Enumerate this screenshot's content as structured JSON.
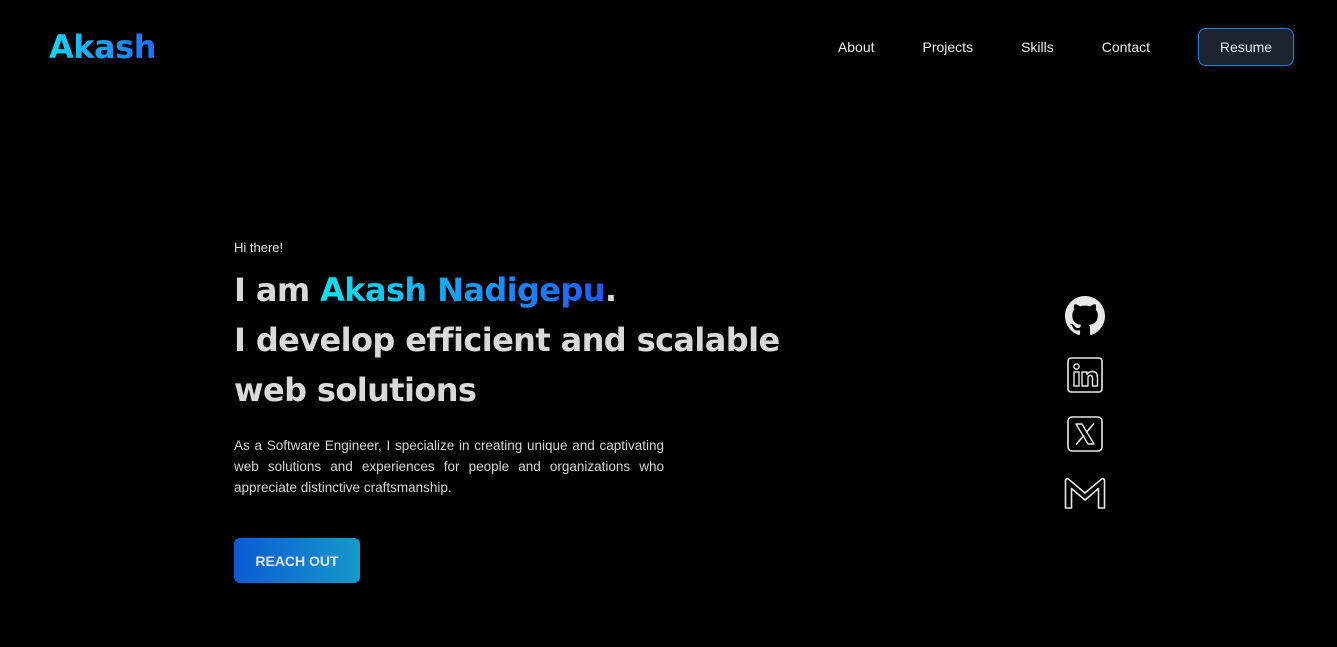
{
  "brand": {
    "logo": "Akash"
  },
  "nav": {
    "links": [
      "About",
      "Projects",
      "Skills",
      "Contact"
    ],
    "resume_label": "Resume"
  },
  "hero": {
    "greeting": "Hi there!",
    "prefix": "I am ",
    "name": "Akash Nadigepu",
    "dot": ".",
    "line2": "I develop efficient and scalable",
    "line3": "web solutions",
    "description": "As a Software Engineer, I specialize in creating unique and captivating web solutions and experiences for people and organizations who appreciate distinctive craftsmanship.",
    "cta_label": "REACH OUT"
  },
  "socials": [
    "github-icon",
    "linkedin-icon",
    "x-icon",
    "gmail-icon"
  ],
  "colors": {
    "background": "#000000",
    "accent_start": "#10e3ee",
    "accent_end": "#1f5bff"
  }
}
